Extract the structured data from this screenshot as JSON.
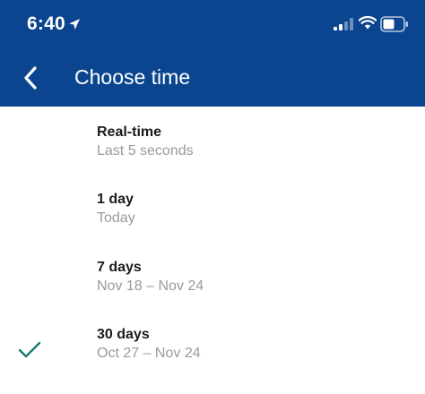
{
  "status_bar": {
    "time": "6:40"
  },
  "header": {
    "title": "Choose time"
  },
  "options": [
    {
      "label": "Real-time",
      "sublabel": "Last 5 seconds",
      "selected": false
    },
    {
      "label": "1 day",
      "sublabel": "Today",
      "selected": false
    },
    {
      "label": "7 days",
      "sublabel": "Nov 18 – Nov 24",
      "selected": false
    },
    {
      "label": "30 days",
      "sublabel": "Oct 27 – Nov 24",
      "selected": true
    }
  ],
  "colors": {
    "header_bg": "#0b4590",
    "check": "#1f7a6f",
    "sublabel": "#9a9a9a"
  },
  "icons": [
    "location-arrow-icon",
    "cellular-signal-icon",
    "wifi-icon",
    "battery-icon",
    "back-chevron-icon",
    "checkmark-icon"
  ]
}
